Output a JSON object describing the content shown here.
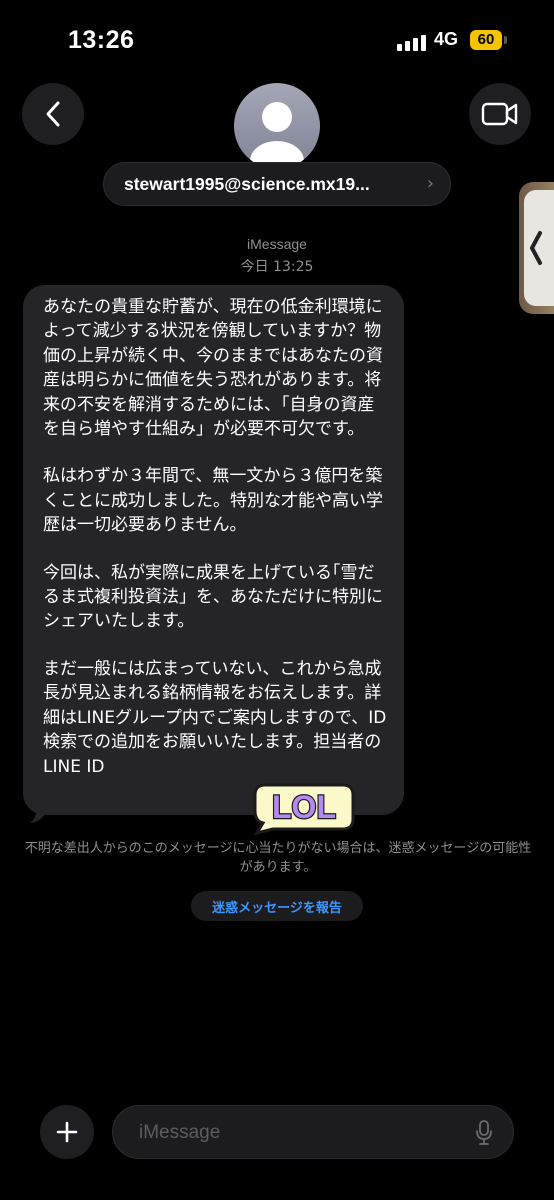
{
  "status_bar": {
    "time": "13:26",
    "network": "4G",
    "battery": "60",
    "battery_color": "#f5c400"
  },
  "header": {
    "back_icon": "chevron-left-icon",
    "video_icon": "video-camera-icon",
    "avatar_icon": "person-silhouette-icon",
    "contact": "stewart1995@science.mx19...",
    "contact_chevron": "›"
  },
  "thread": {
    "service": "iMessage",
    "timestamp": "今日 13:25",
    "message_paragraphs": [
      "あなたの貴重な貯蓄が、現在の低金利環境によって減少する状況を傍観していますか？物価の上昇が続く中、今のままではあなたの資産は明らかに価値を失う恐れがあります。将来の不安を解消するためには、｢自身の資産を自ら増やす仕組み」が必要不可欠です。",
      "私はわずか３年間で、無一文から３億円を築くことに成功しました。特別な才能や高い学歴は一切必要ありません。",
      "今回は、私が実際に成果を上げている｢雪だるま式複利投資法」を、あなただけに特別にシェアいたします。",
      "まだ一般には広まっていない、これから急成長が見込まれる銘柄情報をお伝えします。詳細はLINEグループ内でご案内しますので、ID検索での追加をお願いいたします。担当者のLINE ID"
    ],
    "sticker_text": "LOL",
    "warning": "不明な差出人からのこのメッセージに心当たりがない場合は、迷惑メッセージの可能性があります。",
    "report_label": "迷惑メッセージを報告",
    "accent_color": "#3c96ff"
  },
  "composer": {
    "placeholder": "iMessage",
    "plus_icon": "plus-icon",
    "mic_icon": "microphone-icon"
  }
}
